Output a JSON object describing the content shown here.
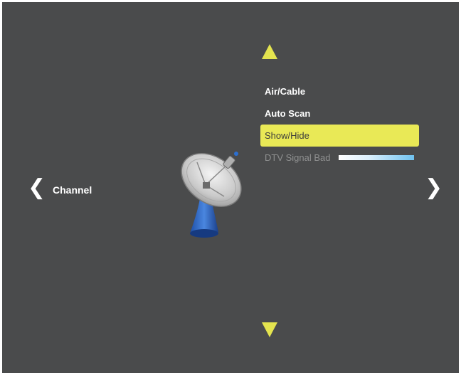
{
  "category": {
    "label": "Channel"
  },
  "nav": {
    "left_glyph": "❮",
    "right_glyph": "❯"
  },
  "menu": {
    "items": [
      {
        "label": "Air/Cable",
        "state": "normal"
      },
      {
        "label": "Auto Scan",
        "state": "normal"
      },
      {
        "label": "Show/Hide",
        "state": "selected"
      },
      {
        "label": "DTV Signal Bad",
        "state": "disabled"
      }
    ]
  },
  "icons": {
    "category": "satellite-dish-icon",
    "scroll_up": "triangle-up-icon",
    "scroll_down": "triangle-down-icon"
  },
  "colors": {
    "background": "#4a4b4c",
    "highlight": "#e9e956",
    "arrows": "#e4e44f",
    "signal_bar_start": "#ffffff",
    "signal_bar_end": "#6fc2ef"
  }
}
